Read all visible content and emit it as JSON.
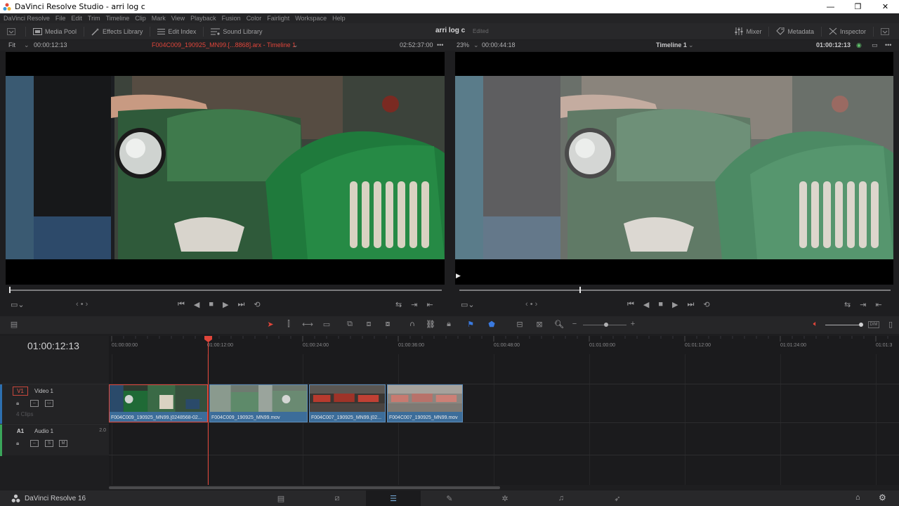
{
  "window": {
    "title": "DaVinci Resolve Studio - arri log c",
    "minimize": "—",
    "maximize": "❐",
    "close": "✕"
  },
  "menu": [
    "DaVinci Resolve",
    "File",
    "Edit",
    "Trim",
    "Timeline",
    "Clip",
    "Mark",
    "View",
    "Playback",
    "Fusion",
    "Color",
    "Fairlight",
    "Workspace",
    "Help"
  ],
  "toolbar": {
    "media_pool": "Media Pool",
    "effects_library": "Effects Library",
    "edit_index": "Edit Index",
    "sound_library": "Sound Library",
    "project_name": "arri log c",
    "project_status": "Edited",
    "mixer": "Mixer",
    "metadata": "Metadata",
    "inspector": "Inspector"
  },
  "source_viewer": {
    "zoom": "Fit",
    "timecode_in": "00:00:12:13",
    "clip_name": "F004C009_190925_MN99.[...8868].arx - Timeline 1",
    "duration": "02:52:37:00"
  },
  "timeline_viewer": {
    "zoom": "23%",
    "timecode_in": "00:00:44:18",
    "timeline_name": "Timeline 1",
    "timecode": "01:00:12:13"
  },
  "timeline": {
    "current_timecode": "01:00:12:13",
    "ruler": [
      "01:00:00:00",
      "01:00:12:00",
      "01:00:24:00",
      "01:00:36:00",
      "01:00:48:00",
      "01:01:00:00",
      "01:01:12:00",
      "01:01:24:00",
      "01:01:3"
    ],
    "video_track": {
      "id": "V1",
      "name": "Video 1",
      "clip_count": "4 Clips"
    },
    "audio_track": {
      "id": "A1",
      "name": "Audio 1",
      "channels": "2.0",
      "solo": "S",
      "mute": "M"
    },
    "clips": [
      {
        "name": "F004C009_190925_MN99.[0248568-02..."
      },
      {
        "name": "F004C009_190925_MN99.mov"
      },
      {
        "name": "F004C007_190925_MN99.[02..."
      },
      {
        "name": "F004C007_190925_MN99.mov"
      }
    ]
  },
  "pagebar": {
    "brand": "DaVinci Resolve 16"
  },
  "colors": {
    "accent_red": "#e0453a",
    "clip_blue": "#3c6d9a",
    "page_active": "#7ab0e0"
  }
}
